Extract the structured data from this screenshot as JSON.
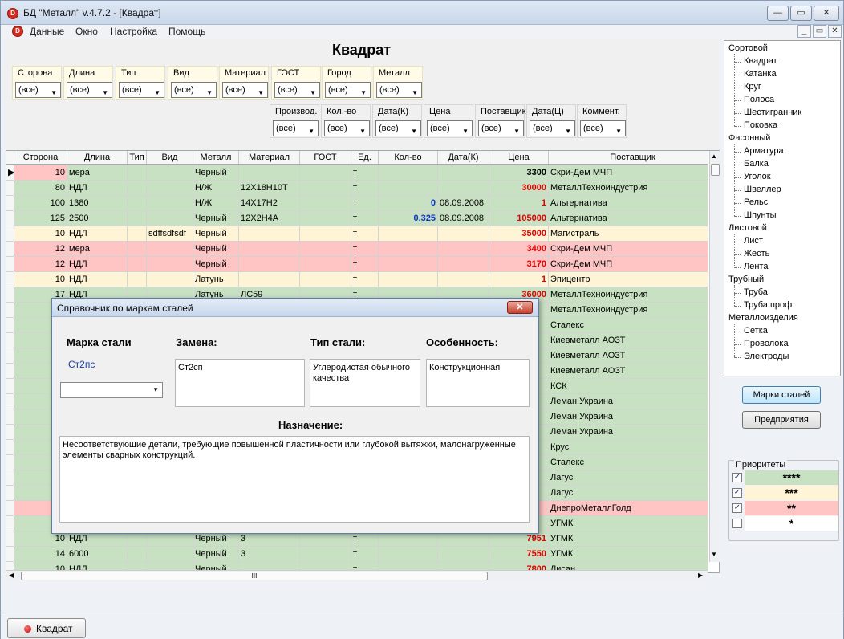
{
  "window": {
    "title": "БД \"Металл\" v.4.7.2 - [Квадрат]",
    "app_icon": "D",
    "minimize": "—",
    "restore": "▭",
    "close": "✕"
  },
  "menu": {
    "items": [
      "Данные",
      "Окно",
      "Настройка",
      "Помощь"
    ],
    "mdi_min": "_",
    "mdi_restore": "▭",
    "mdi_close": "✕"
  },
  "form": {
    "title": "Квадрат"
  },
  "filters_row1": [
    {
      "label": "Сторона",
      "value": "(все)"
    },
    {
      "label": "Длина",
      "value": "(все)"
    },
    {
      "label": "Тип",
      "value": "(все)"
    },
    {
      "label": "Вид",
      "value": "(все)"
    },
    {
      "label": "Материал",
      "value": "(все)"
    },
    {
      "label": "ГОСТ",
      "value": "(все)"
    },
    {
      "label": "Город",
      "value": "(все)"
    },
    {
      "label": "Металл",
      "value": "(все)"
    }
  ],
  "filters_row2": [
    {
      "label": "Производ.",
      "value": "(все)"
    },
    {
      "label": "Кол.-во",
      "value": "(все)"
    },
    {
      "label": "Дата(К)",
      "value": "(все)"
    },
    {
      "label": "Цена",
      "value": "(все)"
    },
    {
      "label": "Поставщик",
      "value": "(все)"
    },
    {
      "label": "Дата(Ц)",
      "value": "(все)"
    },
    {
      "label": "Коммент.",
      "value": "(все)"
    }
  ],
  "grid": {
    "columns": [
      "",
      "Сторона",
      "Длина",
      "Тип",
      "Вид",
      "Металл",
      "Материал",
      "ГОСТ",
      "Ед.",
      "Кол-во",
      "Дата(К)",
      "Цена",
      "Поставщик"
    ],
    "rows": [
      {
        "c": "pink",
        "sel": "▶",
        "side": "10",
        "len": "мера",
        "typ": "",
        "vid": "",
        "met": "Черный",
        "mat": "",
        "gost": "",
        "ed": "т",
        "qty": "",
        "qc": "",
        "date": "",
        "price": "3300",
        "pc": "black",
        "sup": "Скри-Дем МЧП",
        "sidebg": "pink",
        "rest": "green"
      },
      {
        "c": "green",
        "sel": "",
        "side": "80",
        "len": "НДЛ",
        "typ": "",
        "vid": "",
        "met": "Н/Ж",
        "mat": "12Х18Н10Т",
        "gost": "",
        "ed": "т",
        "qty": "",
        "qc": "",
        "date": "",
        "price": "30000",
        "pc": "red",
        "sup": "МеталлТехноиндустрия"
      },
      {
        "c": "green",
        "sel": "",
        "side": "100",
        "len": "1380",
        "typ": "",
        "vid": "",
        "met": "Н/Ж",
        "mat": "14Х17Н2",
        "gost": "",
        "ed": "т",
        "qty": "0",
        "qc": "blue",
        "date": "08.09.2008",
        "price": "1",
        "pc": "red",
        "sup": "Альтернатива"
      },
      {
        "c": "green",
        "sel": "",
        "side": "125",
        "len": "2500",
        "typ": "",
        "vid": "",
        "met": "Черный",
        "mat": "12Х2Н4А",
        "gost": "",
        "ed": "т",
        "qty": "0,325",
        "qc": "blue",
        "date": "08.09.2008",
        "price": "105000",
        "pc": "red",
        "sup": "Альтернатива"
      },
      {
        "c": "yellow",
        "sel": "",
        "side": "10",
        "len": "НДЛ",
        "typ": "",
        "vid": "sdffsdfsdf",
        "met": "Черный",
        "mat": "",
        "gost": "",
        "ed": "т",
        "qty": "",
        "qc": "",
        "date": "",
        "price": "35000",
        "pc": "red",
        "sup": "Магистраль"
      },
      {
        "c": "pink",
        "sel": "",
        "side": "12",
        "len": "мера",
        "typ": "",
        "vid": "",
        "met": "Черный",
        "mat": "",
        "gost": "",
        "ed": "т",
        "qty": "",
        "qc": "",
        "date": "",
        "price": "3400",
        "pc": "red",
        "sup": "Скри-Дем МЧП"
      },
      {
        "c": "pink",
        "sel": "",
        "side": "12",
        "len": "НДЛ",
        "typ": "",
        "vid": "",
        "met": "Черный",
        "mat": "",
        "gost": "",
        "ed": "т",
        "qty": "",
        "qc": "",
        "date": "",
        "price": "3170",
        "pc": "red",
        "sup": "Скри-Дем МЧП"
      },
      {
        "c": "yellow",
        "sel": "",
        "side": "10",
        "len": "НДЛ",
        "typ": "",
        "vid": "",
        "met": "Латунь",
        "mat": "",
        "gost": "",
        "ed": "т",
        "qty": "",
        "qc": "",
        "date": "",
        "price": "1",
        "pc": "red",
        "sup": "Эпицентр"
      },
      {
        "c": "green",
        "sel": "",
        "side": "17",
        "len": "НДЛ",
        "typ": "",
        "vid": "",
        "met": "Латунь",
        "mat": "ЛС59",
        "gost": "",
        "ed": "т",
        "qty": "",
        "qc": "",
        "date": "",
        "price": "36000",
        "pc": "red",
        "sup": "МеталлТехноиндустрия"
      },
      {
        "c": "green",
        "sel": "",
        "side": "",
        "len": "",
        "typ": "",
        "vid": "",
        "met": "",
        "mat": "",
        "gost": "",
        "ed": "",
        "qty": "",
        "qc": "",
        "date": "",
        "price": "",
        "pc": "red",
        "sup": "МеталлТехноиндустрия"
      },
      {
        "c": "green",
        "sel": "",
        "side": "",
        "len": "",
        "typ": "",
        "vid": "",
        "met": "",
        "mat": "",
        "gost": "",
        "ed": "",
        "qty": "",
        "qc": "",
        "date": "",
        "price": "",
        "pc": "red",
        "sup": "Сталекс"
      },
      {
        "c": "green",
        "sel": "",
        "side": "",
        "len": "",
        "typ": "",
        "vid": "",
        "met": "",
        "mat": "",
        "gost": "",
        "ed": "",
        "qty": "",
        "qc": "",
        "date": "",
        "price": "",
        "pc": "red",
        "sup": "Киевметалл АОЗТ"
      },
      {
        "c": "green",
        "sel": "",
        "side": "",
        "len": "",
        "typ": "",
        "vid": "",
        "met": "",
        "mat": "",
        "gost": "",
        "ed": "",
        "qty": "",
        "qc": "",
        "date": "",
        "price": "",
        "pc": "red",
        "sup": "Киевметалл АОЗТ"
      },
      {
        "c": "green",
        "sel": "",
        "side": "",
        "len": "",
        "typ": "",
        "vid": "",
        "met": "",
        "mat": "",
        "gost": "",
        "ed": "",
        "qty": "",
        "qc": "",
        "date": "",
        "price": "",
        "pc": "red",
        "sup": "Киевметалл АОЗТ"
      },
      {
        "c": "green",
        "sel": "",
        "side": "",
        "len": "",
        "typ": "",
        "vid": "",
        "met": "",
        "mat": "",
        "gost": "",
        "ed": "",
        "qty": "",
        "qc": "",
        "date": "",
        "price": "",
        "pc": "red",
        "sup": "КСК"
      },
      {
        "c": "green",
        "sel": "",
        "side": "",
        "len": "",
        "typ": "",
        "vid": "",
        "met": "",
        "mat": "",
        "gost": "",
        "ed": "",
        "qty": "",
        "qc": "",
        "date": "",
        "price": "",
        "pc": "red",
        "sup": "Леман Украина"
      },
      {
        "c": "green",
        "sel": "",
        "side": "",
        "len": "",
        "typ": "",
        "vid": "",
        "met": "",
        "mat": "",
        "gost": "",
        "ed": "",
        "qty": "",
        "qc": "",
        "date": "",
        "price": "",
        "pc": "red",
        "sup": "Леман Украина"
      },
      {
        "c": "green",
        "sel": "",
        "side": "",
        "len": "",
        "typ": "",
        "vid": "",
        "met": "",
        "mat": "",
        "gost": "",
        "ed": "",
        "qty": "",
        "qc": "",
        "date": "",
        "price": "",
        "pc": "red",
        "sup": "Леман Украина"
      },
      {
        "c": "green",
        "sel": "",
        "side": "",
        "len": "",
        "typ": "",
        "vid": "",
        "met": "",
        "mat": "",
        "gost": "",
        "ed": "",
        "qty": "",
        "qc": "",
        "date": "",
        "price": "",
        "pc": "red",
        "sup": "Крус"
      },
      {
        "c": "green",
        "sel": "",
        "side": "",
        "len": "",
        "typ": "",
        "vid": "",
        "met": "",
        "mat": "",
        "gost": "",
        "ed": "",
        "qty": "",
        "qc": "",
        "date": "",
        "price": "",
        "pc": "red",
        "sup": "Сталекс"
      },
      {
        "c": "green",
        "sel": "",
        "side": "",
        "len": "",
        "typ": "",
        "vid": "",
        "met": "",
        "mat": "",
        "gost": "",
        "ed": "",
        "qty": "",
        "qc": "",
        "date": "",
        "price": "",
        "pc": "red",
        "sup": "Лагус"
      },
      {
        "c": "green",
        "sel": "",
        "side": "",
        "len": "",
        "typ": "",
        "vid": "",
        "met": "",
        "mat": "",
        "gost": "",
        "ed": "",
        "qty": "",
        "qc": "",
        "date": "",
        "price": "",
        "pc": "red",
        "sup": "Лагус"
      },
      {
        "c": "pink",
        "sel": "",
        "side": "",
        "len": "",
        "typ": "",
        "vid": "",
        "met": "",
        "mat": "",
        "gost": "",
        "ed": "",
        "qty": "",
        "qc": "",
        "date": "",
        "price": "",
        "pc": "red",
        "sup": "ДнепроМеталлГолд"
      },
      {
        "c": "green",
        "sel": "",
        "side": "",
        "len": "",
        "typ": "",
        "vid": "",
        "met": "",
        "mat": "",
        "gost": "",
        "ed": "",
        "qty": "",
        "qc": "",
        "date": "",
        "price": "",
        "pc": "red",
        "sup": "УГМК"
      },
      {
        "c": "green",
        "sel": "",
        "side": "10",
        "len": "НДЛ",
        "typ": "",
        "vid": "",
        "met": "Черный",
        "mat": "3",
        "gost": "",
        "ed": "т",
        "qty": "",
        "qc": "",
        "date": "",
        "price": "7951",
        "pc": "red",
        "sup": "УГМК"
      },
      {
        "c": "green",
        "sel": "",
        "side": "14",
        "len": "6000",
        "typ": "",
        "vid": "",
        "met": "Черный",
        "mat": "3",
        "gost": "",
        "ed": "т",
        "qty": "",
        "qc": "",
        "date": "",
        "price": "7550",
        "pc": "red",
        "sup": "УГМК"
      },
      {
        "c": "green",
        "sel": "",
        "side": "10",
        "len": "НДЛ",
        "typ": "",
        "vid": "",
        "met": "Черный",
        "mat": "",
        "gost": "",
        "ed": "т",
        "qty": "",
        "qc": "",
        "date": "",
        "price": "7800",
        "pc": "red",
        "sup": "Лисан"
      }
    ],
    "hscroll_grip": "III"
  },
  "tree": {
    "groups": [
      {
        "label": "Сортовой",
        "children": [
          "Квадрат",
          "Катанка",
          "Круг",
          "Полоса",
          "Шестигранник",
          "Поковка"
        ]
      },
      {
        "label": "Фасонный",
        "children": [
          "Арматура",
          "Балка",
          "Уголок",
          "Швеллер",
          "Рельс",
          "Шпунты"
        ]
      },
      {
        "label": "Листовой",
        "children": [
          "Лист",
          "Жесть",
          "Лента"
        ]
      },
      {
        "label": "Трубный",
        "children": [
          "Труба",
          "Труба проф."
        ]
      },
      {
        "label": "Металлоизделия",
        "children": [
          "Сетка",
          "Проволока",
          "Электроды"
        ]
      }
    ]
  },
  "buttons": {
    "steel_grades": "Марки сталей",
    "enterprises": "Предприятия"
  },
  "priorities": {
    "title": "Приоритеты",
    "items": [
      {
        "stars": "****",
        "checked": true,
        "color": "#c8e1c2"
      },
      {
        "stars": "***",
        "checked": true,
        "color": "#fff5d6"
      },
      {
        "stars": "**",
        "checked": true,
        "color": "#ffc4c4"
      },
      {
        "stars": "*",
        "checked": false,
        "color": "#ffffff"
      }
    ]
  },
  "taskbar": {
    "button": "Квадрат"
  },
  "dialog": {
    "title": "Справочник по маркам сталей",
    "close": "✕",
    "grade_label": "Марка стали",
    "grade_value": "Ст2пс",
    "replacement_label": "Замена:",
    "replacement_value": "Ст2сп",
    "type_label": "Тип стали:",
    "type_value": "Углеродистая обычного качества",
    "feature_label": "Особенность:",
    "feature_value": "Конструкционная",
    "purpose_label": "Назначение:",
    "purpose_value": "Несоответствующие детали, требующие повышенной пластичности или глубокой вытяжки, малонагруженные элементы сварных конструкций."
  },
  "colors": {
    "green": "#c8e1c2",
    "yellow": "#fff5d6",
    "pink": "#ffc4c4",
    "price_red": "#e00000",
    "qty_blue": "#0a36c4"
  }
}
